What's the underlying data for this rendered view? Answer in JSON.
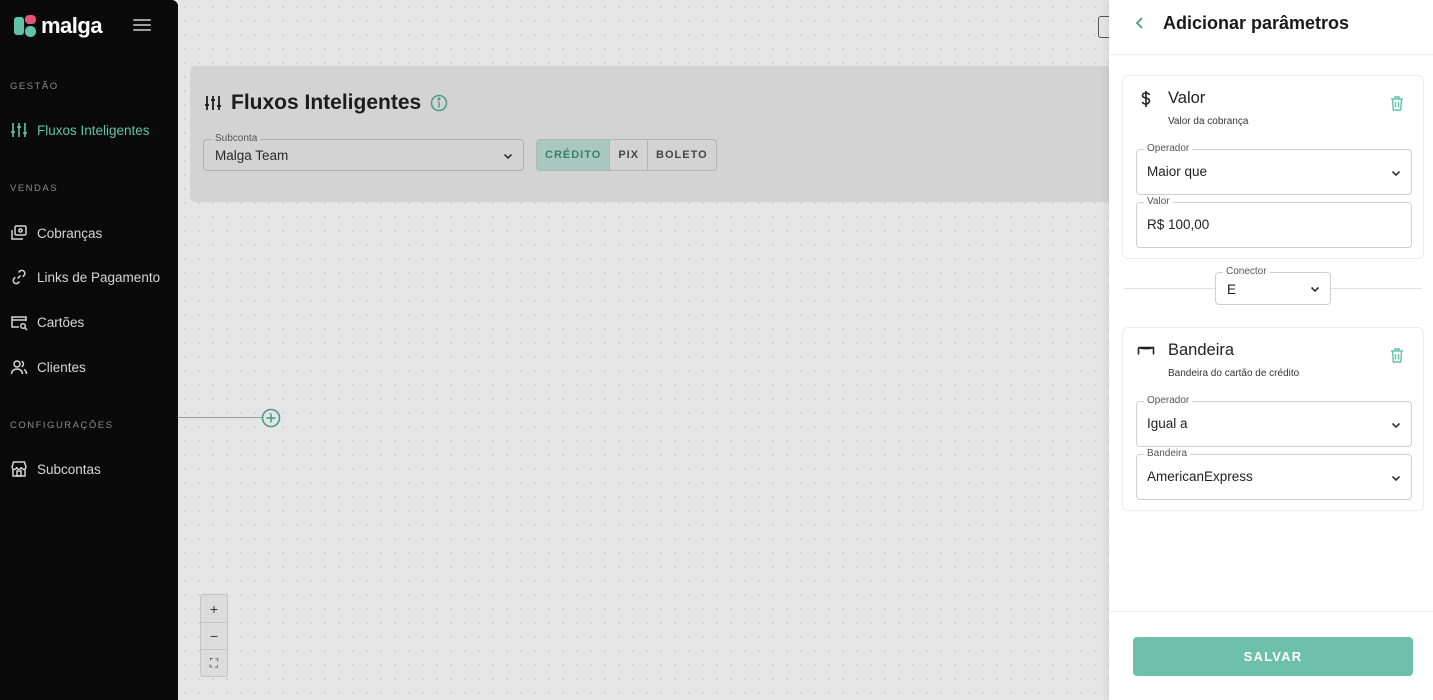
{
  "sidebar": {
    "logo_text": "malga",
    "sections": {
      "gestao": "GESTÃO",
      "vendas": "VENDAS",
      "configuracoes": "CONFIGURAÇÕES"
    },
    "items": {
      "fluxos": "Fluxos Inteligentes",
      "cobrancas": "Cobranças",
      "links": "Links de Pagamento",
      "cartoes": "Cartões",
      "clientes": "Clientes",
      "subcontas": "Subcontas"
    }
  },
  "main": {
    "title": "Fluxos Inteligentes",
    "subconta": {
      "label": "Subconta",
      "value": "Malga Team"
    },
    "methods": [
      "CRÉDITO",
      "PIX",
      "BOLETO"
    ],
    "active_method": "CRÉDITO",
    "zoom": {
      "in": "+",
      "out": "−",
      "fit": "⛶"
    }
  },
  "panel": {
    "title": "Adicionar parâmetros",
    "valor_card": {
      "title": "Valor",
      "subtitle": "Valor da cobrança",
      "operator_label": "Operador",
      "operator_value": "Maior que",
      "value_label": "Valor",
      "value_value": "R$ 100,00"
    },
    "connector": {
      "label": "Conector",
      "value": "E"
    },
    "bandeira_card": {
      "title": "Bandeira",
      "subtitle": "Bandeira do cartão de crédito",
      "operator_label": "Operador",
      "operator_value": "Igual a",
      "brand_label": "Bandeira",
      "brand_value": "AmericanExpress"
    },
    "save_label": "SALVAR"
  },
  "colors": {
    "accent": "#5fc3a8",
    "save_button": "#6dc1aa",
    "sidebar_bg": "#0a0a0a"
  }
}
